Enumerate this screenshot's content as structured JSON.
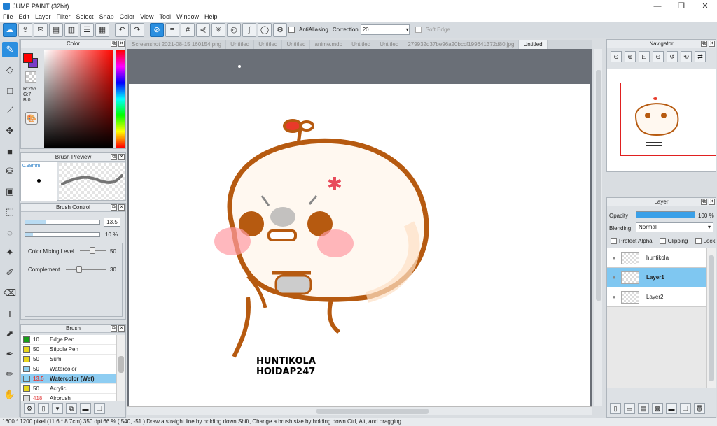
{
  "app": {
    "title": "JUMP PAINT (32bit)"
  },
  "menu": [
    "File",
    "Edit",
    "Layer",
    "Filter",
    "Select",
    "Snap",
    "Color",
    "View",
    "Tool",
    "Window",
    "Help"
  ],
  "toolbar": {
    "antialiasing_label": "AntiAliasing",
    "correction_label": "Correction",
    "correction_value": "20",
    "softedge_label": "Soft Edge"
  },
  "color_panel": {
    "title": "Color",
    "r": "R:255",
    "g": "G:7",
    "b": "B:0",
    "fg_color": "#ff0000",
    "bg_color": "#7a3cc8"
  },
  "brush_preview": {
    "title": "Brush Preview",
    "size": "0.98mm"
  },
  "brush_control": {
    "title": "Brush Control",
    "size_value": "13.5",
    "opacity_value": "10",
    "opacity_unit": "%",
    "mixing_label": "Color Mixing Level",
    "mixing_value": "50",
    "complement_label": "Complement",
    "complement_value": "30"
  },
  "brush_panel": {
    "title": "Brush",
    "items": [
      {
        "size": "10",
        "name": "Edge Pen",
        "color": "#18a018"
      },
      {
        "size": "50",
        "name": "Stipple Pen",
        "color": "#e8d61c"
      },
      {
        "size": "50",
        "name": "Sumi",
        "color": "#e8d61c"
      },
      {
        "size": "50",
        "name": "Watercolor",
        "color": "#8cd0f0"
      },
      {
        "size": "13.5",
        "name": "Watercolor (Wet)",
        "color": "#8cd0f0"
      },
      {
        "size": "50",
        "name": "Acrylic",
        "color": "#e8d61c"
      },
      {
        "size": "418",
        "name": "Airbrush",
        "color": "#ddd"
      }
    ]
  },
  "tabs": [
    "Screenshot 2021-08-15 160154.png",
    "Untitled",
    "Untitled",
    "Untitled",
    "anime.mdp",
    "Untitled",
    "Untitled",
    "279932d37be96a20bccf199641372d80.jpg",
    "Untitled"
  ],
  "artwork": {
    "caption_line1": "HUNTIKOLA",
    "caption_line2": "HOIDAP247"
  },
  "navigator": {
    "title": "Navigator"
  },
  "layer_panel": {
    "title": "Layer",
    "opacity_label": "Opacity",
    "opacity_value": "100",
    "opacity_unit": "%",
    "blending_label": "Blending",
    "blending_value": "Normal",
    "protect_alpha": "Protect Alpha",
    "clipping": "Clipping",
    "lock": "Lock",
    "layers": [
      {
        "name": "huntikola",
        "selected": false
      },
      {
        "name": "Layer1",
        "selected": true
      },
      {
        "name": "Layer2",
        "selected": false
      }
    ]
  },
  "status": {
    "text": "1600 * 1200 pixel   (11.6 * 8.7cm)   350 dpi   66 %   ( 540, -51 )   Draw a straight line by holding down Shift, Change a brush size by holding down Ctrl, Alt, and dragging"
  }
}
